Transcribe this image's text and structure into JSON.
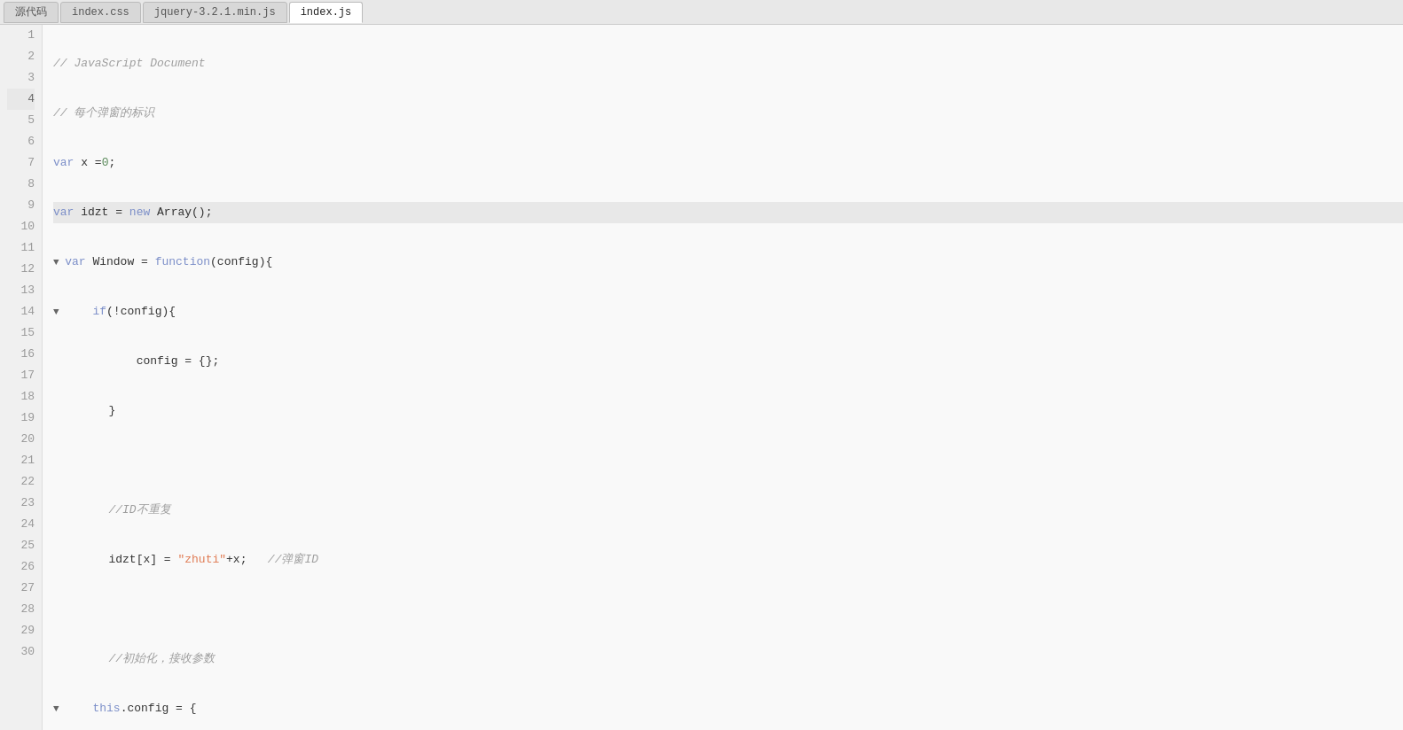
{
  "tabs": [
    {
      "id": "source-tab",
      "label": "源代码",
      "active": false
    },
    {
      "id": "index-css-tab",
      "label": "index.css",
      "active": false
    },
    {
      "id": "jquery-tab",
      "label": "jquery-3.2.1.min.js",
      "active": false
    },
    {
      "id": "index-js-tab",
      "label": "index.js",
      "active": true
    }
  ],
  "lines": [
    {
      "num": 1,
      "highlighted": false
    },
    {
      "num": 2,
      "highlighted": false
    },
    {
      "num": 3,
      "highlighted": false
    },
    {
      "num": 4,
      "highlighted": true
    },
    {
      "num": 5,
      "highlighted": false
    },
    {
      "num": 6,
      "highlighted": false
    },
    {
      "num": 7,
      "highlighted": false
    },
    {
      "num": 8,
      "highlighted": false
    },
    {
      "num": 9,
      "highlighted": false
    },
    {
      "num": 10,
      "highlighted": false
    },
    {
      "num": 11,
      "highlighted": false
    },
    {
      "num": 12,
      "highlighted": false
    },
    {
      "num": 13,
      "highlighted": false
    },
    {
      "num": 14,
      "highlighted": false
    },
    {
      "num": 15,
      "highlighted": false
    },
    {
      "num": 16,
      "highlighted": false
    },
    {
      "num": 17,
      "highlighted": false
    },
    {
      "num": 18,
      "highlighted": false
    },
    {
      "num": 19,
      "highlighted": false
    },
    {
      "num": 20,
      "highlighted": false
    },
    {
      "num": 21,
      "highlighted": false
    },
    {
      "num": 22,
      "highlighted": false
    },
    {
      "num": 23,
      "highlighted": false
    },
    {
      "num": 24,
      "highlighted": false
    },
    {
      "num": 25,
      "highlighted": false
    },
    {
      "num": 26,
      "highlighted": false
    },
    {
      "num": 27,
      "highlighted": false
    },
    {
      "num": 28,
      "highlighted": false
    },
    {
      "num": 29,
      "highlighted": false
    },
    {
      "num": 30,
      "highlighted": false
    }
  ]
}
